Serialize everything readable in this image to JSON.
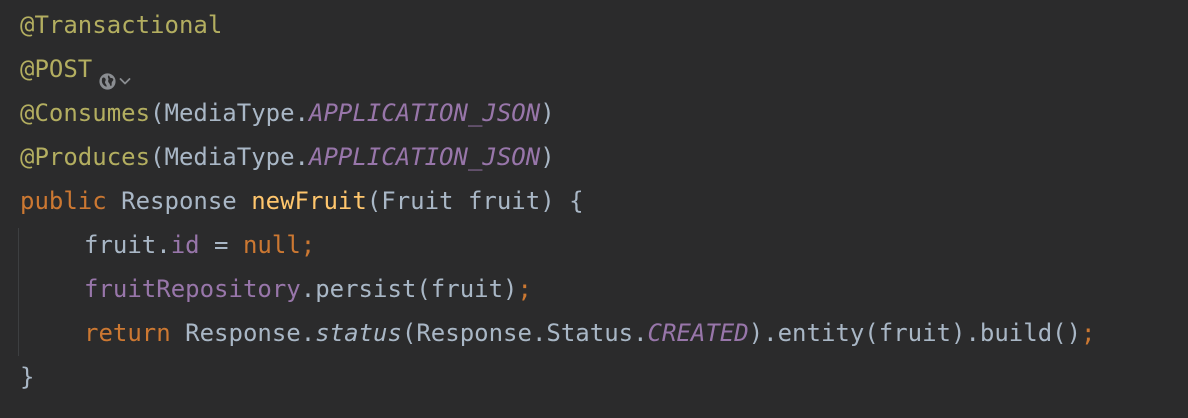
{
  "code": {
    "line1": {
      "annotation": "@Transactional"
    },
    "line2": {
      "annotation": "@POST"
    },
    "line3": {
      "annotation": "@Consumes",
      "open": "(",
      "type": "MediaType.",
      "constant": "APPLICATION_JSON",
      "close": ")"
    },
    "line4": {
      "annotation": "@Produces",
      "open": "(",
      "type": "MediaType.",
      "constant": "APPLICATION_JSON",
      "close": ")"
    },
    "line5": {
      "keyword": "public",
      "return_type": "Response",
      "method": "newFruit",
      "params": "(Fruit fruit) {"
    },
    "line6": {
      "object": "fruit.",
      "field": "id",
      "assign": " = ",
      "value": "null",
      "semi": ";"
    },
    "line7": {
      "field": "fruitRepository",
      "call": ".persist(fruit)",
      "semi": ";"
    },
    "line8": {
      "keyword": "return",
      "part1": "Response.",
      "static_call": "status",
      "part2": "(Response.Status.",
      "constant": "CREATED",
      "part3": ").entity(fruit).build()",
      "semi": ";"
    },
    "line9": {
      "brace": "}"
    }
  },
  "colors": {
    "background": "#2b2b2c",
    "annotation": "#b3ae60",
    "keyword": "#cc7832",
    "method": "#ffc66d",
    "field": "#9876aa",
    "text": "#a9b7c6"
  },
  "icons": {
    "endpoint": "globe-icon",
    "dropdown": "chevron-down-icon"
  }
}
